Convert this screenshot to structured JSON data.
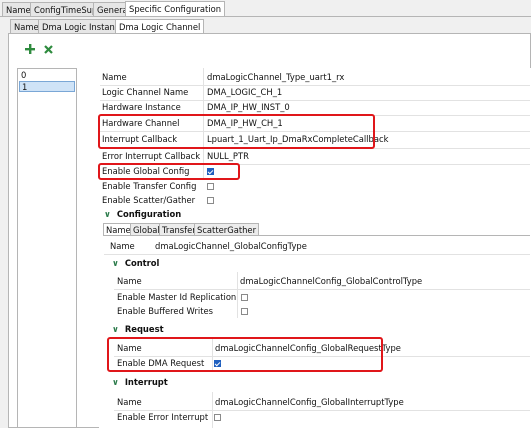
{
  "top_tabs": [
    "Name",
    "ConfigTimeSupport",
    "General",
    "Specific Configuration"
  ],
  "sub_tabs": [
    "Name",
    "Dma Logic Instance",
    "Dma Logic Channel"
  ],
  "toolbar": {
    "add_icon": "plus-icon",
    "remove_icon": "x-icon"
  },
  "list_items": [
    "0",
    "1"
  ],
  "fields": {
    "name": {
      "label": "Name",
      "value": "dmaLogicChannel_Type_uart1_rx"
    },
    "logic_channel_name": {
      "label": "Logic Channel Name",
      "value": "DMA_LOGIC_CH_1"
    },
    "hardware_instance": {
      "label": "Hardware Instance",
      "value": "DMA_IP_HW_INST_0"
    },
    "hardware_channel": {
      "label": "Hardware Channel",
      "value": "DMA_IP_HW_CH_1"
    },
    "interrupt_callback": {
      "label": "Interrupt Callback",
      "value": "Lpuart_1_Uart_Ip_DmaRxCompleteCallback"
    },
    "error_interrupt_callback": {
      "label": "Error Interrupt Callback",
      "value": "NULL_PTR"
    },
    "enable_global_config": {
      "label": "Enable Global Config",
      "checked": true
    },
    "enable_transfer_config": {
      "label": "Enable Transfer Config",
      "checked": false
    },
    "enable_scatter_gather": {
      "label": "Enable Scatter/Gather",
      "checked": false
    }
  },
  "configuration": {
    "title": "Configuration",
    "tabs": [
      "Name",
      "Global",
      "Transfer",
      "ScatterGather"
    ],
    "name": {
      "label": "Name",
      "value": "dmaLogicChannel_GlobalConfigType"
    },
    "control": {
      "title": "Control",
      "name": {
        "label": "Name",
        "value": "dmaLogicChannelConfig_GlobalControlType"
      },
      "master_id": {
        "label": "Enable Master Id Replication",
        "checked": false
      },
      "buffered_writes": {
        "label": "Enable Buffered Writes",
        "checked": false
      }
    },
    "request": {
      "title": "Request",
      "name": {
        "label": "Name",
        "value": "dmaLogicChannelConfig_GlobalRequestType"
      },
      "enable_dma_request": {
        "label": "Enable DMA Request",
        "checked": true
      }
    },
    "interrupt": {
      "title": "Interrupt",
      "name": {
        "label": "Name",
        "value": "dmaLogicChannelConfig_GlobalInterruptType"
      },
      "enable_error_interrupt": {
        "label": "Enable Error Interrupt",
        "checked": false
      }
    }
  },
  "colors": {
    "accent": "#1f5fbf",
    "highlight_box": "#e0161a",
    "chevron": "#2a7a4a"
  }
}
